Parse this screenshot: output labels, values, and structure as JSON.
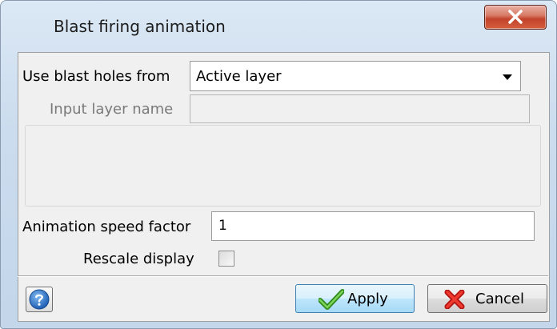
{
  "window": {
    "title": "Blast firing animation"
  },
  "form": {
    "blast_holes_label": "Use blast holes from",
    "blast_holes_value": "Active layer",
    "input_layer_label": "Input layer name",
    "input_layer_value": "",
    "speed_label": "Animation speed factor",
    "speed_value": "1",
    "rescale_label": "Rescale display",
    "rescale_checked": false
  },
  "buttons": {
    "apply_label": "Apply",
    "cancel_label": "Cancel"
  },
  "icons": {
    "close": "close-icon",
    "dropdown": "chevron-down-icon",
    "help": "help-icon",
    "apply": "checkmark-icon",
    "cancel": "x-mark-icon"
  },
  "colors": {
    "close_button": "#c7432b",
    "default_button": "#bee6fd",
    "help_icon": "#2f77cf",
    "apply_icon": "#3a9a22",
    "cancel_icon": "#d8221b"
  }
}
